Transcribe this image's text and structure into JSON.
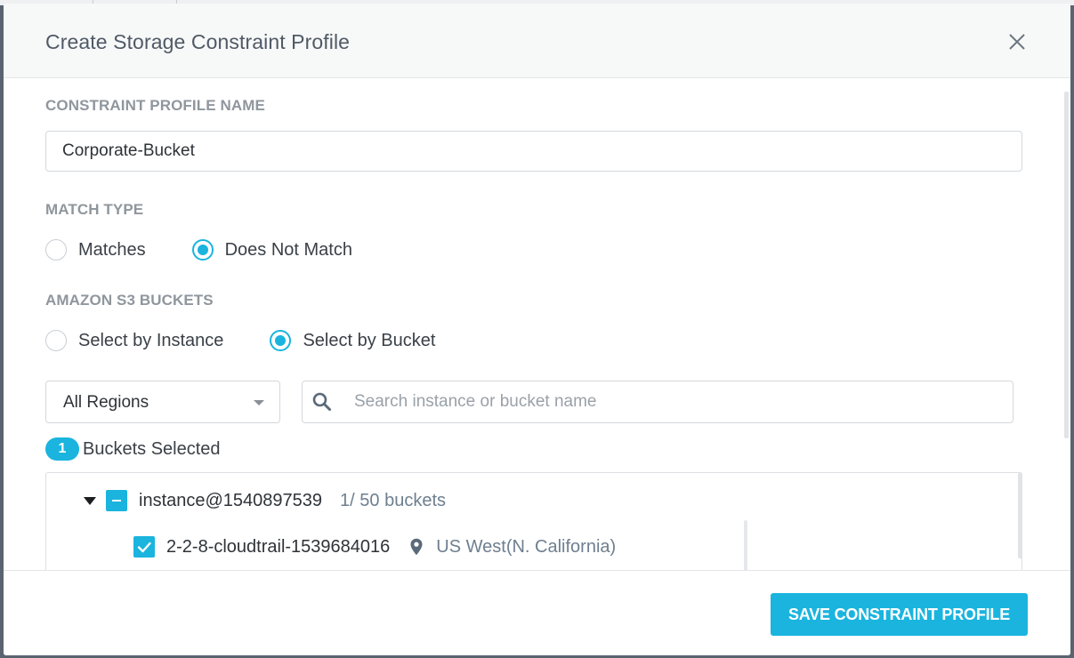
{
  "modal": {
    "title": "Create Storage Constraint Profile"
  },
  "form": {
    "profile_name_label": "CONSTRAINT PROFILE NAME",
    "profile_name_value": "Corporate-Bucket",
    "match_type_label": "MATCH TYPE",
    "match_options": [
      {
        "label": "Matches",
        "checked": false
      },
      {
        "label": "Does Not Match",
        "checked": true
      }
    ],
    "buckets_label": "AMAZON S3 BUCKETS",
    "select_options": [
      {
        "label": "Select by Instance",
        "checked": false
      },
      {
        "label": "Select by Bucket",
        "checked": true
      }
    ],
    "region_dropdown": "All Regions",
    "search_placeholder": "Search instance or bucket name",
    "selected_count": "1",
    "selected_label": "Buckets Selected"
  },
  "tree": {
    "instance": {
      "name": "instance@1540897539",
      "count": "1/ 50 buckets",
      "state": "partial"
    },
    "buckets": [
      {
        "name": "2-2-8-cloudtrail-1539684016",
        "region": "US West(N. California)",
        "checked": true
      }
    ]
  },
  "footer": {
    "save_label": "SAVE CONSTRAINT PROFILE"
  },
  "colors": {
    "accent": "#1ab4de",
    "label_gray": "#8f969d",
    "title_gray": "#505a66"
  },
  "icons": [
    "close-icon",
    "chevron-down-icon",
    "search-icon",
    "expand-triangle-icon",
    "checkbox-partial-icon",
    "checkbox-checked-icon",
    "location-pin-icon"
  ]
}
